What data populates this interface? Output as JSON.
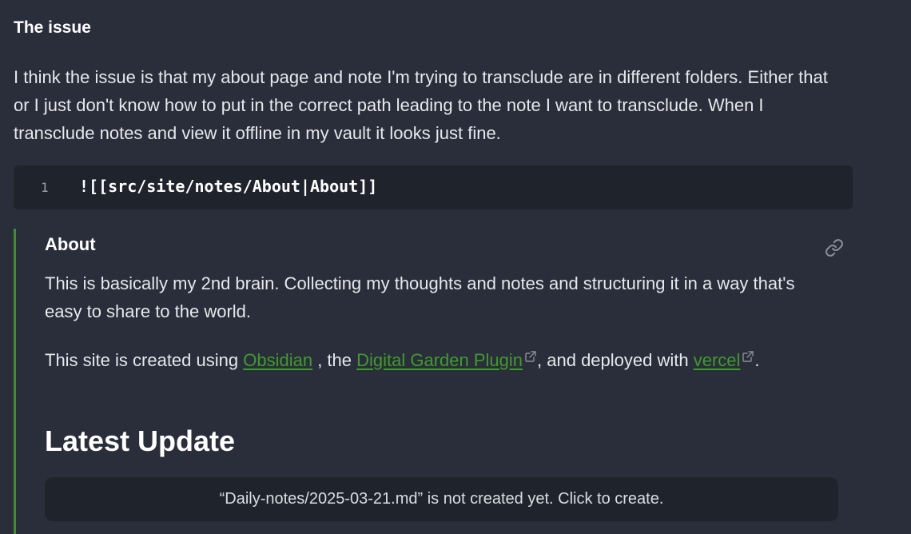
{
  "issue": {
    "heading": "The issue",
    "body": "I think the issue is that my about page and note I'm trying to transclude are in different folders. Either that or I just don't know how to put in the correct path leading to the note I want to transclude. When I transclude notes and view it offline in my vault it looks just fine."
  },
  "code": {
    "line_number": "1",
    "text": "![[src/site/notes/About|About]]"
  },
  "embed": {
    "title": "About",
    "link_icon": "link-icon",
    "paragraph1": "This is basically my 2nd brain. Collecting my thoughts and notes and structuring it in a way that's easy to share to the world.",
    "p2_prefix": "This site is created using ",
    "link_obsidian": "Obsidian",
    "p2_mid1": " , the ",
    "link_digital_garden": "Digital Garden Plugin",
    "p2_mid2": ", and deployed with ",
    "link_vercel": "vercel",
    "p2_suffix": ".",
    "update_heading": "Latest Update",
    "create_notice": "“Daily-notes/2025-03-21.md” is not created yet. Click to create."
  },
  "colors": {
    "background": "#2a2e3a",
    "code_background": "#1f232c",
    "link": "#3f9b2e",
    "embed_border": "#3f8f2e"
  }
}
